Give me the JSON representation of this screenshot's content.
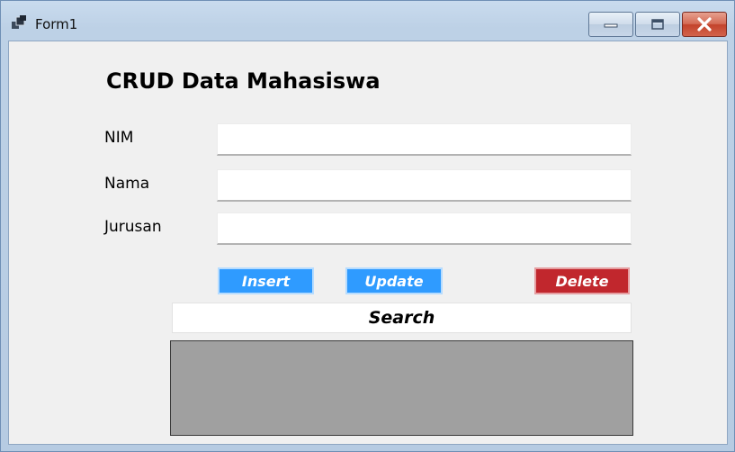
{
  "window": {
    "title": "Form1",
    "controls": {
      "minimize": "minimize-icon",
      "maximize": "maximize-icon",
      "close": "close-icon"
    },
    "colors": {
      "frame": "#b9cde2",
      "client": "#f0f0f0",
      "close": "#c3432b"
    }
  },
  "form": {
    "heading": "CRUD Data Mahasiswa",
    "fields": [
      {
        "label": "NIM",
        "value": "",
        "placeholder": ""
      },
      {
        "label": "Nama",
        "value": "",
        "placeholder": ""
      },
      {
        "label": "Jurusan",
        "value": "",
        "placeholder": ""
      }
    ],
    "buttons": {
      "insert": "Insert",
      "update": "Update",
      "delete": "Delete",
      "search": "Search"
    },
    "colors": {
      "insert": "#2f9bff",
      "update": "#2f9bff",
      "delete": "#c1272d",
      "grid": "#a0a0a0"
    }
  }
}
